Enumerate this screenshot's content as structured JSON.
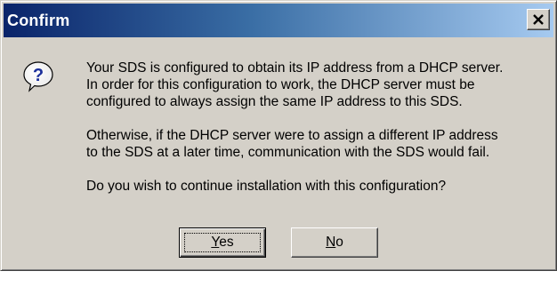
{
  "window": {
    "title": "Confirm",
    "close_glyph": "×"
  },
  "icon": "question-icon",
  "message": {
    "paragraphs": [
      "Your SDS is configured to obtain its IP address from a DHCP server.\nIn order for this configuration to work, the DHCP server must be\nconfigured to always assign the same IP address to this SDS.",
      "Otherwise, if the DHCP server were to assign a different IP address\nto the SDS at a later time, communication with the SDS would fail.",
      "Do you wish to continue installation with this configuration?"
    ]
  },
  "buttons": {
    "yes": {
      "accel": "Y",
      "rest": "es"
    },
    "no": {
      "accel": "N",
      "rest": "o"
    }
  },
  "colors": {
    "title_start": "#0a246a",
    "title_end": "#a6caf0",
    "dialog_bg": "#d4d0c8",
    "icon_blue": "#1a2e9a"
  }
}
